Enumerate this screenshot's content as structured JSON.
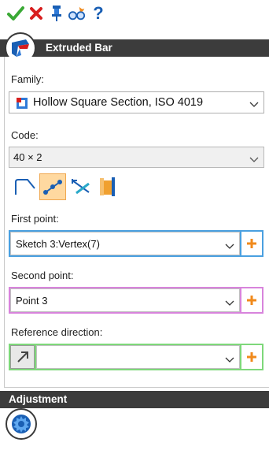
{
  "toolbar": {
    "items": [
      {
        "name": "ok",
        "icon": "checkmark-icon",
        "color": "#3aa935"
      },
      {
        "name": "cancel",
        "icon": "close-icon",
        "color": "#d81e1e"
      },
      {
        "name": "pin",
        "icon": "pin-icon",
        "color": "#1a5fb4"
      },
      {
        "name": "preview",
        "icon": "preview-glasses-icon",
        "color": "#f08a1c"
      },
      {
        "name": "help",
        "icon": "help-icon",
        "glyph": "?",
        "color": "#1a5fb4"
      }
    ]
  },
  "extruded_bar": {
    "title": "Extruded Bar",
    "family": {
      "label": "Family:",
      "value": "Hollow Square Section, ISO 4019"
    },
    "code": {
      "label": "Code:",
      "value": "40 × 2"
    },
    "modes": [
      {
        "icon": "corner-profile-icon",
        "selected": false
      },
      {
        "icon": "two-points-icon",
        "selected": true
      },
      {
        "icon": "length-measure-icon",
        "selected": false
      },
      {
        "icon": "face-profile-icon",
        "selected": false
      }
    ],
    "first_point": {
      "label": "First point:",
      "value": "Sketch 3:Vertex(7)",
      "color": "#4aa0e0"
    },
    "second_point": {
      "label": "Second point:",
      "value": "Point 3",
      "color": "#d884dc"
    },
    "reference_direction": {
      "label": "Reference direction:",
      "value": "",
      "color": "#7ed87a"
    }
  },
  "adjustment": {
    "title": "Adjustment"
  },
  "colors": {
    "header_bg": "#3c3c3c",
    "mode_selected_bg": "#ffd9a0",
    "plus_icon": "#f08a1c"
  }
}
